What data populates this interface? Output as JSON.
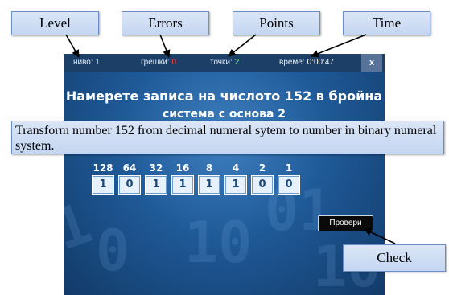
{
  "stats": {
    "level_label": "ниво:",
    "level_value": "1",
    "errors_label": "грешки:",
    "errors_value": "0",
    "points_label": "точки:",
    "points_value": "2",
    "time_label": "време:",
    "time_value": "0:00:47",
    "close_label": "x"
  },
  "task": {
    "line1": "Намерете  записа на числото 152 в бройна",
    "line2": "система с основа 2"
  },
  "weights": [
    "128",
    "64",
    "32",
    "16",
    "8",
    "4",
    "2",
    "1"
  ],
  "bits": [
    "1",
    "0",
    "1",
    "1",
    "1",
    "1",
    "0",
    "0"
  ],
  "check_button_label": "Провери",
  "annotations": {
    "level": "Level",
    "errors": "Errors",
    "points": "Points",
    "time": "Time",
    "check": "Check",
    "translation": "Transform number 152 from decimal numeral sytem to number in binary numeral system."
  },
  "colors": {
    "level_value": "#b6e04a",
    "errors_value": "#ff3b3b",
    "points_value": "#7fe08a"
  }
}
